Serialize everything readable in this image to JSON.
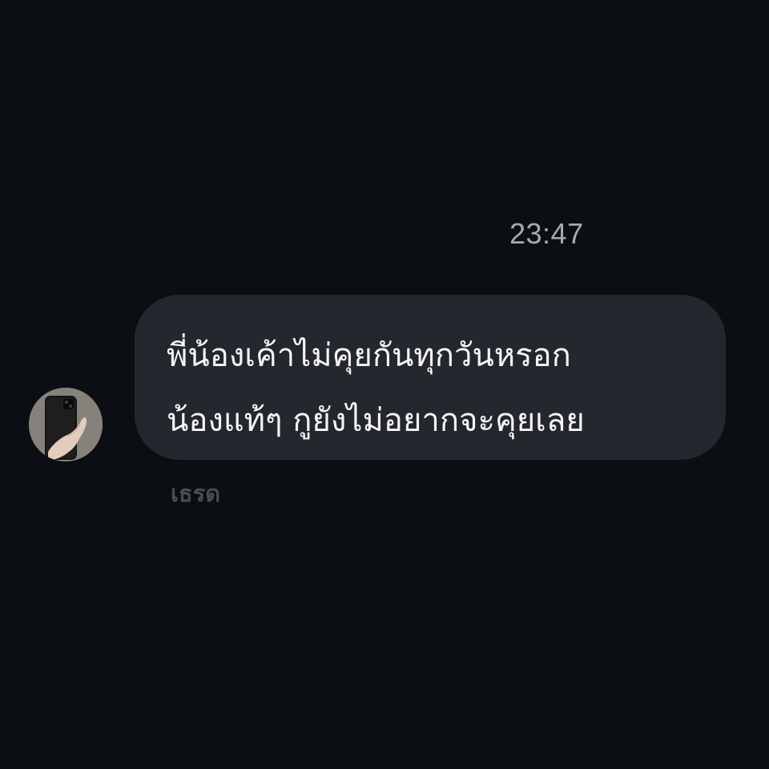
{
  "conversation": {
    "timestamp": "23:47",
    "message": {
      "lines": [
        "พี่น้องเค้าไม่คุยกันทุกวันหรอก",
        "น้องแท้ๆ กูยังไม่อยากจะคุยเลย"
      ],
      "sender_name": "เธรด"
    }
  },
  "colors": {
    "background": "#0b0e13",
    "bubble": "#24272d",
    "message_text": "#f4f4f5",
    "timestamp_text": "#a7a9ae",
    "sender_text": "#4a4d53"
  }
}
